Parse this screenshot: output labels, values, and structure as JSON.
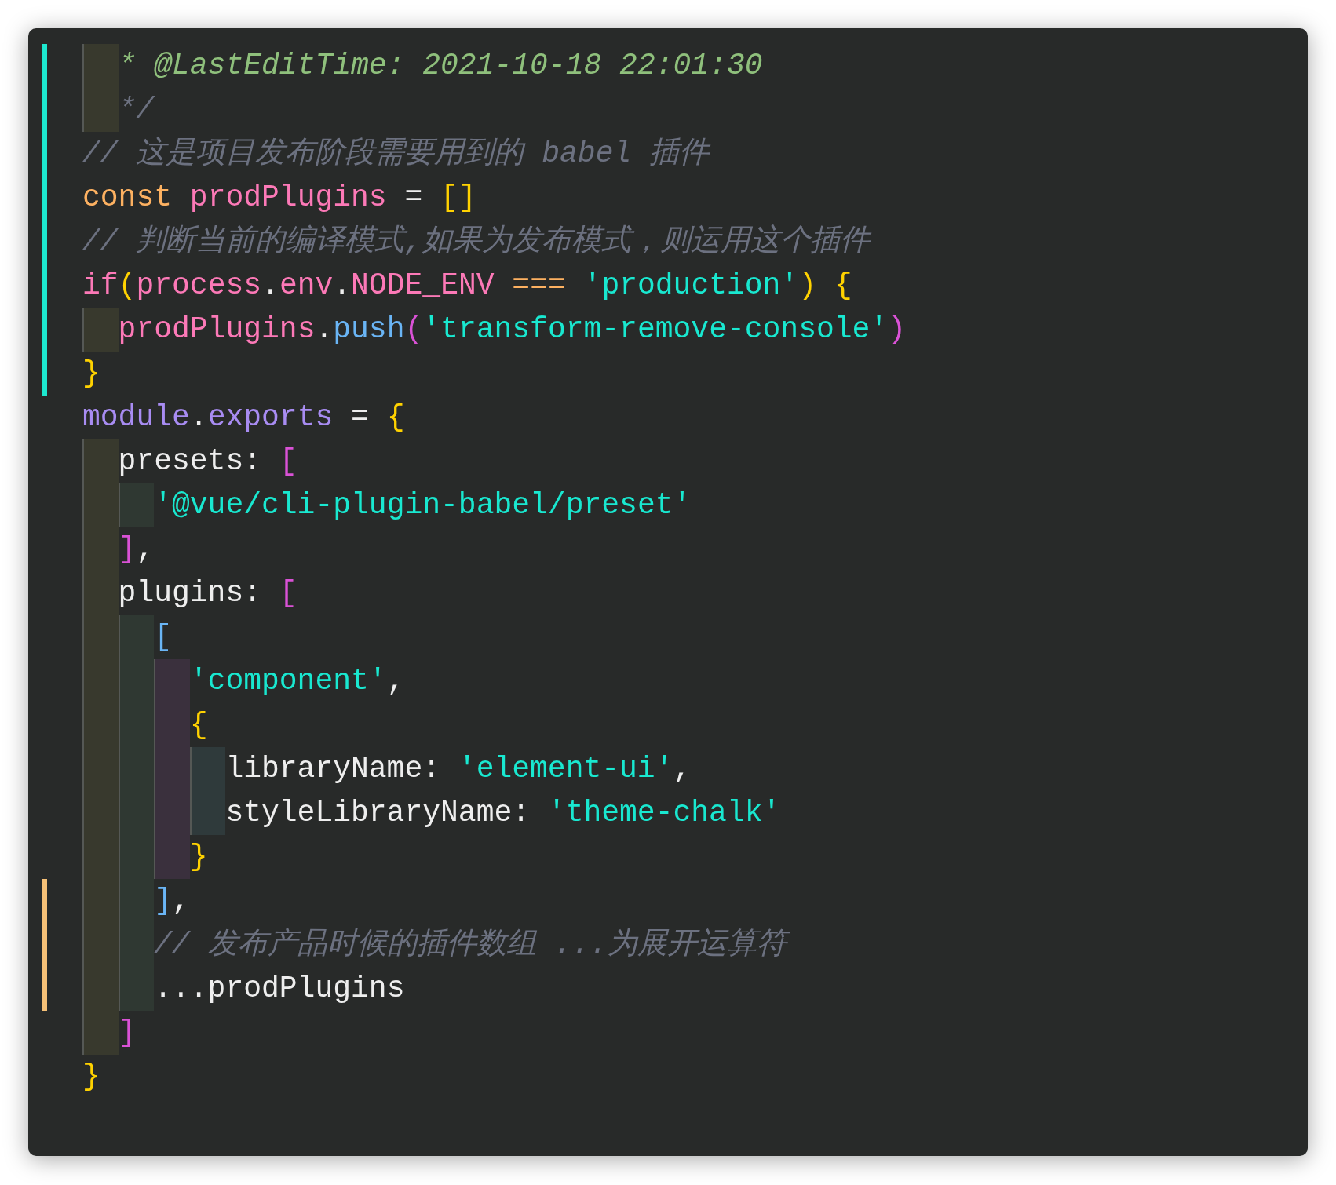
{
  "editor": {
    "lines": [
      {
        "children": [
          {
            "added": true,
            "modified": false,
            "tokens": [
              {
                "kind": "doc",
                "text": "* @LastEditTime: 2021-10-18 22:01:30"
              }
            ]
          },
          {
            "added": true,
            "modified": false,
            "tokens": [
              {
                "kind": "comment",
                "text": "*/"
              }
            ]
          }
        ]
      },
      {
        "added": true,
        "modified": false,
        "tokens": [
          {
            "kind": "comment",
            "text": "// 这是项目发布阶段需要用到的 babel 插件"
          }
        ]
      },
      {
        "added": true,
        "modified": false,
        "tokens": [
          {
            "kind": "keyword",
            "text": "const "
          },
          {
            "kind": "variable",
            "text": "prodPlugins"
          },
          {
            "kind": "plain",
            "text": " = "
          },
          {
            "kind": "bracket-gold",
            "text": "[]"
          }
        ]
      },
      {
        "added": true,
        "modified": false,
        "tokens": [
          {
            "kind": "comment",
            "text": "// 判断当前的编译模式,如果为发布模式，则运用这个插件"
          }
        ]
      },
      {
        "added": true,
        "modified": false,
        "tokens": [
          {
            "kind": "variable",
            "text": "if"
          },
          {
            "kind": "bracket-gold",
            "text": "("
          },
          {
            "kind": "variable",
            "text": "process"
          },
          {
            "kind": "plain",
            "text": "."
          },
          {
            "kind": "variable",
            "text": "env"
          },
          {
            "kind": "plain",
            "text": "."
          },
          {
            "kind": "variable",
            "text": "NODE_ENV"
          },
          {
            "kind": "keyword",
            "text": " === "
          },
          {
            "kind": "string",
            "text": "'production'"
          },
          {
            "kind": "bracket-gold",
            "text": ") {"
          }
        ],
        "children": [
          {
            "added": true,
            "modified": false,
            "tokens": [
              {
                "kind": "variable",
                "text": "prodPlugins"
              },
              {
                "kind": "plain",
                "text": "."
              },
              {
                "kind": "method",
                "text": "push"
              },
              {
                "kind": "bracket-magenta",
                "text": "("
              },
              {
                "kind": "string",
                "text": "'transform-remove-console'"
              },
              {
                "kind": "bracket-magenta",
                "text": ")"
              }
            ]
          }
        ]
      },
      {
        "added": true,
        "modified": false,
        "tokens": [
          {
            "kind": "bracket-gold",
            "text": "}"
          }
        ]
      },
      {
        "added": false,
        "modified": false,
        "tokens": [
          {
            "kind": "module",
            "text": "module"
          },
          {
            "kind": "plain",
            "text": "."
          },
          {
            "kind": "module",
            "text": "exports"
          },
          {
            "kind": "plain",
            "text": " = "
          },
          {
            "kind": "bracket-gold",
            "text": "{"
          }
        ],
        "children": [
          {
            "added": false,
            "modified": false,
            "tokens": [
              {
                "kind": "plain",
                "text": "presets: "
              },
              {
                "kind": "bracket-magenta",
                "text": "["
              }
            ],
            "children": [
              {
                "added": false,
                "modified": false,
                "tokens": [
                  {
                    "kind": "string",
                    "text": "'@vue/cli-plugin-babel/preset'"
                  }
                ]
              }
            ]
          },
          {
            "added": false,
            "modified": false,
            "tokens": [
              {
                "kind": "bracket-magenta",
                "text": "]"
              },
              {
                "kind": "plain",
                "text": ","
              }
            ]
          },
          {
            "added": false,
            "modified": false,
            "tokens": [
              {
                "kind": "plain",
                "text": "plugins: "
              },
              {
                "kind": "bracket-magenta",
                "text": "["
              }
            ],
            "children": [
              {
                "added": false,
                "modified": false,
                "tokens": [
                  {
                    "kind": "bracket-blue",
                    "text": "["
                  }
                ],
                "children": [
                  {
                    "added": false,
                    "modified": false,
                    "tokens": [
                      {
                        "kind": "string",
                        "text": "'component'"
                      },
                      {
                        "kind": "plain",
                        "text": ","
                      }
                    ]
                  },
                  {
                    "added": false,
                    "modified": false,
                    "tokens": [
                      {
                        "kind": "bracket-gold",
                        "text": "{"
                      }
                    ],
                    "children": [
                      {
                        "added": false,
                        "modified": false,
                        "tokens": [
                          {
                            "kind": "plain",
                            "text": "libraryName: "
                          },
                          {
                            "kind": "string",
                            "text": "'element-ui'"
                          },
                          {
                            "kind": "plain",
                            "text": ","
                          }
                        ]
                      },
                      {
                        "added": false,
                        "modified": false,
                        "tokens": [
                          {
                            "kind": "plain",
                            "text": "styleLibraryName: "
                          },
                          {
                            "kind": "string",
                            "text": "'theme-chalk'"
                          }
                        ]
                      }
                    ]
                  },
                  {
                    "added": false,
                    "modified": false,
                    "tokens": [
                      {
                        "kind": "bracket-gold",
                        "text": "}"
                      }
                    ]
                  }
                ]
              },
              {
                "added": false,
                "modified": true,
                "tokens": [
                  {
                    "kind": "bracket-blue",
                    "text": "]"
                  },
                  {
                    "kind": "plain",
                    "text": ","
                  }
                ]
              },
              {
                "added": false,
                "modified": true,
                "tokens": [
                  {
                    "kind": "comment",
                    "text": "// 发布产品时候的插件数组 ...为展开运算符"
                  }
                ]
              },
              {
                "added": false,
                "modified": true,
                "tokens": [
                  {
                    "kind": "plain",
                    "text": "...prodPlugins"
                  }
                ]
              }
            ]
          },
          {
            "added": false,
            "modified": false,
            "tokens": [
              {
                "kind": "bracket-magenta",
                "text": "]"
              }
            ]
          }
        ]
      },
      {
        "added": false,
        "modified": false,
        "tokens": [
          {
            "kind": "bracket-gold",
            "text": "}"
          }
        ]
      }
    ]
  }
}
